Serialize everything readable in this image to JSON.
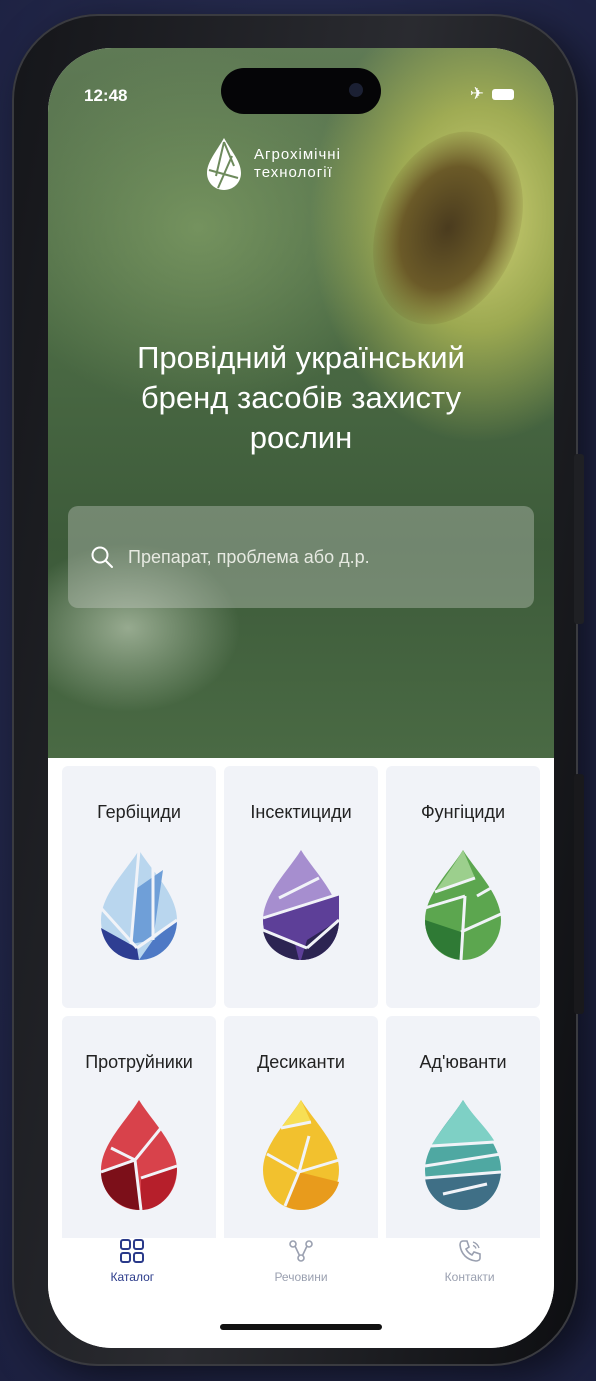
{
  "status": {
    "time": "12:48"
  },
  "logo": {
    "line1": "Агрохімічні",
    "line2": "технології"
  },
  "hero": {
    "headline_lines": [
      "Провідний український",
      "бренд засобів захисту",
      "рослин"
    ]
  },
  "search": {
    "placeholder": "Препарат, проблема або д.р."
  },
  "categories": [
    {
      "label": "Гербіциди",
      "colors": [
        "#b9d6ee",
        "#6f9fd8",
        "#2e3e92",
        "#4e79c5"
      ]
    },
    {
      "label": "Інсектициди",
      "colors": [
        "#a68ecf",
        "#6b4fa6",
        "#2c2452",
        "#5d3f98"
      ]
    },
    {
      "label": "Фунгіциди",
      "colors": [
        "#9ccf8d",
        "#5ca64f",
        "#2f7a35",
        "#4b9a46"
      ]
    },
    {
      "label": "Протруйники",
      "colors": [
        "#d8424b",
        "#b61f2b",
        "#7c0f19",
        "#c32a35"
      ]
    },
    {
      "label": "Десиканти",
      "colors": [
        "#f7df55",
        "#f2c12e",
        "#e89b1c",
        "#f5b632"
      ]
    },
    {
      "label": "Ад'юванти",
      "colors": [
        "#7ed0c5",
        "#4fa8a2",
        "#3f6f86",
        "#5fa3b0"
      ]
    }
  ],
  "tabs": [
    {
      "label": "Каталог",
      "icon": "grid-icon",
      "active": true
    },
    {
      "label": "Речовини",
      "icon": "molecule-icon",
      "active": false
    },
    {
      "label": "Контакти",
      "icon": "phone-icon",
      "active": false
    }
  ],
  "colors": {
    "accent": "#2a3a8a",
    "inactive": "#9aa0b0"
  }
}
